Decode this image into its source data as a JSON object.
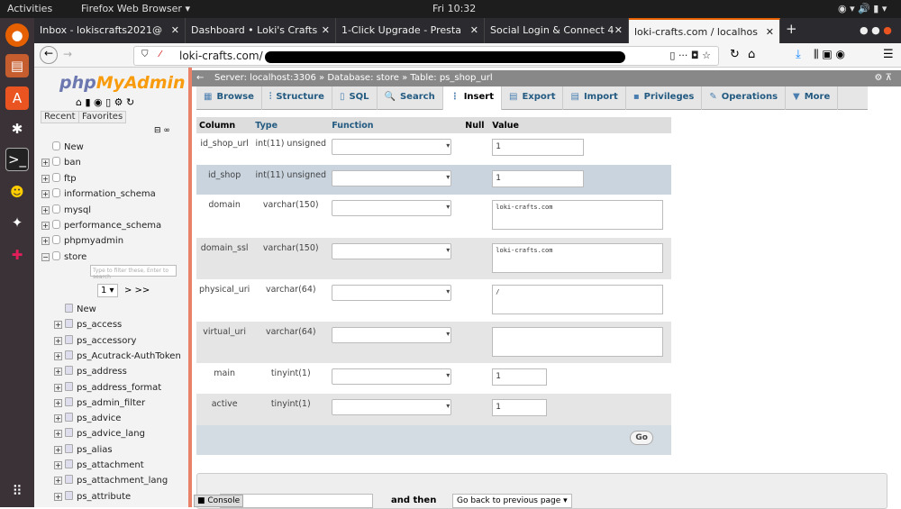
{
  "system": {
    "activities": "Activities",
    "app": "Firefox Web Browser ▾",
    "clock": "Fri 10:32"
  },
  "tabs": [
    {
      "label": "Inbox - lokiscrafts2021@"
    },
    {
      "label": "Dashboard • Loki's Crafts"
    },
    {
      "label": "1-Click Upgrade - Presta"
    },
    {
      "label": "Social Login & Connect 4"
    },
    {
      "label": "loki-crafts.com / localhos"
    }
  ],
  "url": "loki-crafts.com/",
  "sidebar": {
    "logo_php": "php",
    "logo_my": "MyAdmin",
    "recent": "Recent",
    "favorites": "Favorites",
    "filter_placeholder": "Type to filter these, Enter to search",
    "page": "1",
    "pager": "> >>",
    "databases": [
      "New",
      "ban",
      "ftp",
      "information_schema",
      "mysql",
      "performance_schema",
      "phpmyadmin",
      "store"
    ],
    "tables": [
      "New",
      "ps_access",
      "ps_accessory",
      "ps_Acutrack-AuthToken",
      "ps_address",
      "ps_address_format",
      "ps_admin_filter",
      "ps_advice",
      "ps_advice_lang",
      "ps_alias",
      "ps_attachment",
      "ps_attachment_lang",
      "ps_attribute"
    ]
  },
  "breadcrumb": {
    "server": "Server: localhost:3306",
    "database": "Database: store",
    "table": "Table: ps_shop_url"
  },
  "main_tabs": [
    "Browse",
    "Structure",
    "SQL",
    "Search",
    "Insert",
    "Export",
    "Import",
    "Privileges",
    "Operations",
    "More"
  ],
  "headers": {
    "column": "Column",
    "type": "Type",
    "function": "Function",
    "null": "Null",
    "value": "Value"
  },
  "rows": [
    {
      "column": "id_shop_url",
      "type": "int(11) unsigned",
      "value": "1",
      "kind": "input"
    },
    {
      "column": "id_shop",
      "type": "int(11) unsigned",
      "value": "1",
      "kind": "input"
    },
    {
      "column": "domain",
      "type": "varchar(150)",
      "value": "loki-crafts.com",
      "kind": "text"
    },
    {
      "column": "domain_ssl",
      "type": "varchar(150)",
      "value": "loki-crafts.com",
      "kind": "text"
    },
    {
      "column": "physical_uri",
      "type": "varchar(64)",
      "value": "/",
      "kind": "text"
    },
    {
      "column": "virtual_uri",
      "type": "varchar(64)",
      "value": "",
      "kind": "text"
    },
    {
      "column": "main",
      "type": "tinyint(1)",
      "value": "1",
      "kind": "small"
    },
    {
      "column": "active",
      "type": "tinyint(1)",
      "value": "1",
      "kind": "small"
    }
  ],
  "go": "Go",
  "bottom": {
    "console": "Console",
    "and_then": "and then",
    "after": "Go back to previous page"
  }
}
